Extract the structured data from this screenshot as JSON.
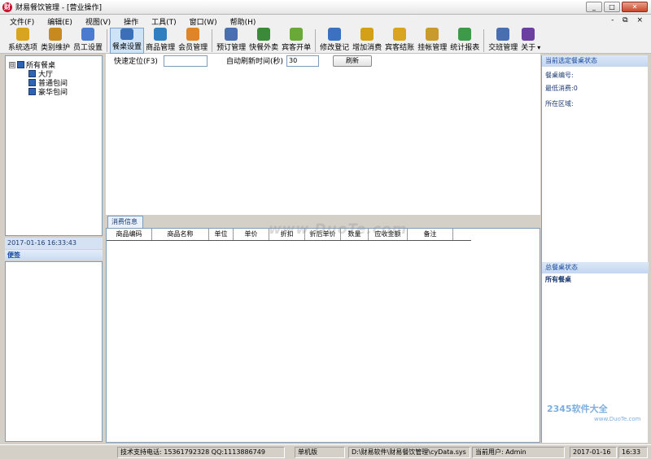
{
  "window": {
    "title": "财易餐饮管理 - [营业操作]",
    "app_icon_char": "财"
  },
  "window_buttons": [
    "_",
    "□",
    "✕"
  ],
  "mdi_buttons": "- ⧉ ×",
  "menu": [
    "文件(F)",
    "编辑(E)",
    "视图(V)",
    "操作",
    "工具(T)",
    "窗口(W)",
    "帮助(H)"
  ],
  "toolbar": [
    {
      "label": "系统选项",
      "color": "#d9a520"
    },
    {
      "label": "类别维护",
      "color": "#c78a1e"
    },
    {
      "label": "员工设置",
      "color": "#4b7bd0"
    },
    {
      "label": "餐桌设置",
      "color": "#3b6fb7",
      "active": true
    },
    {
      "label": "商品管理",
      "color": "#2f7fc1"
    },
    {
      "label": "会员管理",
      "color": "#e0842a"
    },
    {
      "label": "预订管理",
      "color": "#4a6fb0"
    },
    {
      "label": "快餐外卖",
      "color": "#3a8a3a"
    },
    {
      "label": "宾客开单",
      "color": "#6aa838"
    },
    {
      "label": "修改登记",
      "color": "#3c70c0"
    },
    {
      "label": "增加消费",
      "color": "#d4a017"
    },
    {
      "label": "宾客结账",
      "color": "#d9a520"
    },
    {
      "label": "挂帐管理",
      "color": "#c99a2e"
    },
    {
      "label": "统计报表",
      "color": "#3c9a4a"
    },
    {
      "label": "交班管理",
      "color": "#4a6fb0"
    },
    {
      "label": "关于",
      "color": "#6a3fa0"
    }
  ],
  "tree": {
    "root": "所有餐桌",
    "toggle": "⊟",
    "children": [
      "大厅",
      "普通包间",
      "豪华包间"
    ]
  },
  "datetime": "2017-01-16  16:33:43",
  "memo": {
    "title": "便签"
  },
  "filters": {
    "quick_locate_label": "快速定位(F3)",
    "quick_locate_value": "",
    "auto_refresh_label": "自动刷新时间(秒)",
    "auto_refresh_value": "30",
    "refresh_button": "刷新"
  },
  "consumption": {
    "tab": "消费信息",
    "columns": [
      "商品编码",
      "商品名称",
      "单位",
      "单价",
      "折扣",
      "折后单价",
      "数量",
      "应收金额",
      "备注"
    ]
  },
  "right_panel": {
    "header": "当前选定餐桌状态",
    "fields": [
      "餐桌编号:",
      "最低消费:0",
      "所在区域:"
    ],
    "header2": "总餐桌状态",
    "field2": "所有餐桌"
  },
  "watermark": "www.DuoTe.com",
  "logo": {
    "brand": "2345软件大全",
    "url": "www.DuoTe.com"
  },
  "status": {
    "support": "技术支持电话: 15361792328 QQ:1113886749",
    "edition": "单机版",
    "path": "D:\\财易软件\\财易餐饮管理\\cyData.sys",
    "user": "当前用户: Admin",
    "date": "2017-01-16",
    "time": "16:33"
  }
}
